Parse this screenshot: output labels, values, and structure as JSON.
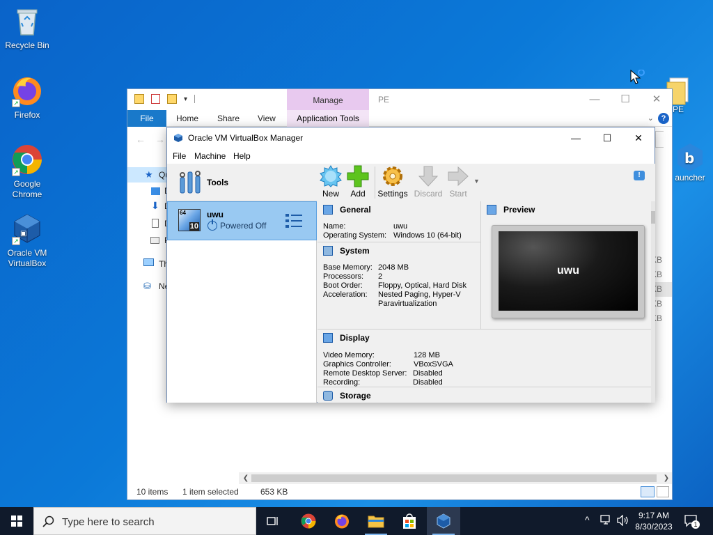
{
  "desktop": {
    "icons": [
      {
        "label": "Recycle Bin"
      },
      {
        "label": "Firefox"
      },
      {
        "label": "Google Chrome"
      },
      {
        "label": "Oracle VM VirtualBox"
      },
      {
        "label": "PE"
      },
      {
        "label": "auncher"
      }
    ]
  },
  "explorer": {
    "manage_label": "Manage",
    "window_name": "PE",
    "tabs": {
      "file": "File",
      "home": "Home",
      "share": "Share",
      "view": "View",
      "app_tools": "Application Tools"
    },
    "nav_items": [
      "Qu",
      "D",
      "D",
      "D",
      "P",
      "Th",
      "Ne"
    ],
    "sizes": [
      "KB",
      "KB",
      "KB",
      "KB",
      "KB"
    ],
    "status": {
      "items": "10 items",
      "selected": "1 item selected",
      "size": "653 KB"
    }
  },
  "vbox": {
    "title": "Oracle VM VirtualBox Manager",
    "menu": {
      "file": "File",
      "machine": "Machine",
      "help": "Help"
    },
    "tools_label": "Tools",
    "vm": {
      "name": "uwu",
      "state": "Powered Off",
      "badge_64": "64",
      "badge_10": "10"
    },
    "toolbar": {
      "new": "New",
      "add": "Add",
      "settings": "Settings",
      "discard": "Discard",
      "start": "Start"
    },
    "general": {
      "header": "General",
      "name_k": "Name:",
      "name_v": "uwu",
      "os_k": "Operating System:",
      "os_v": "Windows 10 (64-bit)"
    },
    "system": {
      "header": "System",
      "mem_k": "Base Memory:",
      "mem_v": "2048 MB",
      "proc_k": "Processors:",
      "proc_v": "2",
      "boot_k": "Boot Order:",
      "boot_v": "Floppy, Optical, Hard Disk",
      "acc_k": "Acceleration:",
      "acc_v1": "Nested Paging, Hyper-V",
      "acc_v2": "Paravirtualization"
    },
    "preview": {
      "header": "Preview",
      "screen_text": "uwu"
    },
    "display": {
      "header": "Display",
      "vmem_k": "Video Memory:",
      "vmem_v": "128 MB",
      "gc_k": "Graphics Controller:",
      "gc_v": "VBoxSVGA",
      "rds_k": "Remote Desktop Server:",
      "rds_v": "Disabled",
      "rec_k": "Recording:",
      "rec_v": "Disabled"
    },
    "storage": {
      "header": "Storage"
    }
  },
  "taskbar": {
    "search_placeholder": "Type here to search",
    "time": "9:17 AM",
    "date": "8/30/2023",
    "notif_count": "1"
  }
}
